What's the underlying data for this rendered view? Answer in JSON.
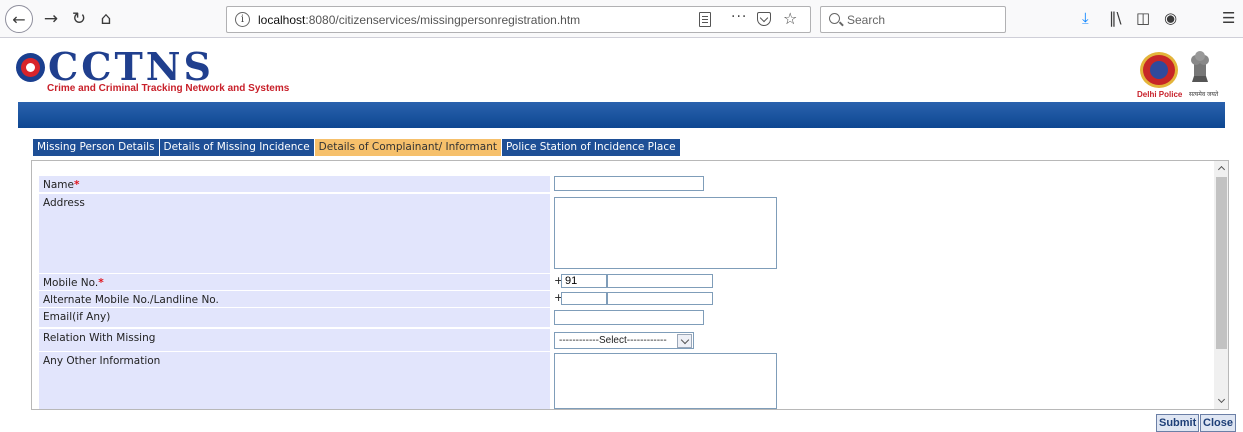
{
  "browser": {
    "url_prefix": "localhost",
    "url_rest": ":8080/citizenservices/missingpersonregistration.htm",
    "more_glyph": "···",
    "search_placeholder": "Search"
  },
  "header": {
    "logo_title": "CCTNS",
    "logo_subtitle": "Crime and Criminal Tracking Network and Systems",
    "police_label": "Delhi Police",
    "emblem_label": "सत्यमेव जयते"
  },
  "tabs": [
    {
      "label": "Missing Person Details"
    },
    {
      "label": "Details of Missing Incidence"
    },
    {
      "label": "Details of Complainant/ Informant"
    },
    {
      "label": "Police Station of Incidence Place"
    }
  ],
  "form": {
    "name_label": "Name",
    "address_label": "Address",
    "mobile_label": "Mobile No.",
    "alt_mobile_label": "Alternate Mobile No./Landline No.",
    "email_label": "Email(if Any)",
    "relation_label": "Relation With Missing",
    "other_info_label": "Any Other Information",
    "required_mark": "*",
    "plus": "+",
    "mobile_code": "91",
    "relation_selected": "------------Select------------"
  },
  "buttons": {
    "submit": "Submit",
    "close": "Close"
  }
}
